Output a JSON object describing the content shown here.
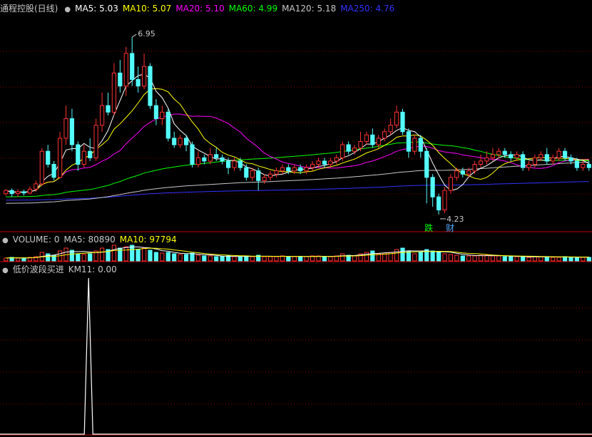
{
  "price_panel": {
    "title": "通程控股(日线)",
    "ma_labels": [
      {
        "text": "MA5: 5.03",
        "color": "#ffffff"
      },
      {
        "text": "MA10: 5.07",
        "color": "#ffff00"
      },
      {
        "text": "MA20: 5.10",
        "color": "#ff00ff"
      },
      {
        "text": "MA60: 4.99",
        "color": "#00ff00"
      },
      {
        "text": "MA120: 5.18",
        "color": "#c8c8c8"
      },
      {
        "text": "MA250: 4.76",
        "color": "#3333ff"
      }
    ],
    "high_label": "6.95",
    "low_label": "4.23",
    "tag_left": "跌",
    "tag_right": "财"
  },
  "volume_panel": {
    "labels": [
      {
        "text": "VOLUME: 0",
        "color": "#c8c8c8"
      },
      {
        "text": "MA5: 80890",
        "color": "#c8c8c8"
      },
      {
        "text": "MA10: 97794",
        "color": "#ffff00"
      }
    ]
  },
  "indicator_panel": {
    "labels": [
      {
        "text": "低价波段买进",
        "color": "#c8c8c8"
      },
      {
        "text": "KM11: 0.00",
        "color": "#c8c8c8"
      }
    ]
  },
  "colors": {
    "up": "#ff3232",
    "down": "#54fcfc",
    "grid": "#8b0000",
    "border": "#c80000"
  },
  "chart_data": {
    "type": "candlestick",
    "ylim": [
      4.0,
      7.3
    ],
    "candles": [
      [
        4.55,
        4.6,
        4.52,
        4.62
      ],
      [
        4.6,
        4.55,
        4.5,
        4.63
      ],
      [
        4.55,
        4.58,
        4.5,
        4.62
      ],
      [
        4.58,
        4.56,
        4.52,
        4.61
      ],
      [
        4.56,
        4.62,
        4.54,
        4.66
      ],
      [
        4.62,
        4.7,
        4.58,
        4.75
      ],
      [
        4.7,
        5.2,
        4.68,
        5.25
      ],
      [
        5.2,
        5.0,
        4.95,
        5.3
      ],
      [
        5.0,
        4.8,
        4.75,
        5.05
      ],
      [
        4.8,
        5.4,
        4.78,
        5.5
      ],
      [
        5.4,
        5.7,
        5.3,
        5.9
      ],
      [
        5.7,
        5.3,
        5.2,
        5.85
      ],
      [
        5.3,
        5.0,
        4.9,
        5.35
      ],
      [
        5.0,
        5.2,
        4.95,
        5.3
      ],
      [
        5.2,
        5.1,
        5.05,
        5.4
      ],
      [
        5.1,
        5.6,
        5.05,
        5.7
      ],
      [
        5.6,
        5.9,
        5.5,
        6.1
      ],
      [
        5.9,
        5.8,
        5.75,
        6.1
      ],
      [
        5.8,
        6.4,
        5.75,
        6.55
      ],
      [
        6.4,
        6.2,
        6.1,
        6.6
      ],
      [
        6.2,
        6.7,
        6.05,
        6.8
      ],
      [
        6.7,
        6.3,
        6.2,
        6.95
      ],
      [
        6.3,
        6.2,
        6.1,
        6.5
      ],
      [
        6.2,
        6.5,
        6.15,
        6.7
      ],
      [
        6.5,
        5.9,
        5.85,
        6.55
      ],
      [
        5.9,
        5.7,
        5.6,
        6.0
      ],
      [
        5.7,
        5.8,
        5.6,
        5.9
      ],
      [
        5.8,
        5.4,
        5.35,
        5.85
      ],
      [
        5.4,
        5.3,
        5.25,
        5.5
      ],
      [
        5.3,
        5.4,
        5.25,
        5.45
      ],
      [
        5.4,
        5.3,
        5.2,
        5.45
      ],
      [
        5.3,
        5.0,
        4.95,
        5.35
      ],
      [
        5.0,
        5.1,
        4.95,
        5.2
      ],
      [
        5.1,
        5.05,
        5.0,
        5.15
      ],
      [
        5.05,
        5.15,
        5.0,
        5.25
      ],
      [
        5.15,
        5.1,
        5.05,
        5.25
      ],
      [
        5.1,
        5.05,
        5.0,
        5.15
      ],
      [
        5.05,
        4.95,
        4.85,
        5.1
      ],
      [
        4.95,
        5.05,
        4.9,
        5.1
      ],
      [
        5.05,
        4.95,
        4.9,
        5.1
      ],
      [
        4.95,
        4.8,
        4.75,
        5.0
      ],
      [
        4.8,
        4.9,
        4.75,
        4.95
      ],
      [
        4.9,
        4.75,
        4.6,
        4.95
      ],
      [
        4.75,
        4.8,
        4.7,
        4.85
      ],
      [
        4.8,
        4.85,
        4.75,
        4.9
      ],
      [
        4.85,
        4.9,
        4.8,
        4.95
      ],
      [
        4.9,
        4.95,
        4.85,
        5.0
      ],
      [
        4.95,
        4.9,
        4.85,
        5.0
      ],
      [
        4.9,
        4.95,
        4.85,
        5.0
      ],
      [
        4.95,
        4.9,
        4.85,
        5.0
      ],
      [
        4.9,
        4.95,
        4.85,
        5.0
      ],
      [
        4.95,
        5.0,
        4.9,
        5.05
      ],
      [
        5.0,
        5.05,
        4.95,
        5.1
      ],
      [
        5.05,
        5.0,
        4.95,
        5.1
      ],
      [
        5.0,
        5.05,
        4.95,
        5.1
      ],
      [
        5.05,
        5.1,
        5.0,
        5.15
      ],
      [
        5.1,
        5.3,
        5.05,
        5.35
      ],
      [
        5.3,
        5.2,
        5.15,
        5.35
      ],
      [
        5.2,
        5.25,
        5.15,
        5.3
      ],
      [
        5.25,
        5.35,
        5.2,
        5.5
      ],
      [
        5.35,
        5.45,
        5.3,
        5.5
      ],
      [
        5.45,
        5.3,
        5.25,
        5.55
      ],
      [
        5.3,
        5.4,
        5.25,
        5.45
      ],
      [
        5.4,
        5.5,
        5.35,
        5.55
      ],
      [
        5.5,
        5.6,
        5.45,
        5.7
      ],
      [
        5.6,
        5.8,
        5.55,
        5.9
      ],
      [
        5.8,
        5.5,
        5.45,
        5.85
      ],
      [
        5.5,
        5.2,
        5.1,
        5.55
      ],
      [
        5.2,
        5.4,
        5.15,
        5.45
      ],
      [
        5.4,
        5.2,
        5.1,
        5.45
      ],
      [
        5.2,
        4.8,
        4.4,
        5.25
      ],
      [
        4.8,
        4.5,
        4.35,
        4.85
      ],
      [
        4.5,
        4.3,
        4.23,
        4.55
      ],
      [
        4.3,
        4.6,
        4.25,
        4.65
      ],
      [
        4.6,
        4.8,
        4.55,
        4.85
      ],
      [
        4.8,
        4.9,
        4.75,
        4.95
      ],
      [
        4.9,
        4.85,
        4.8,
        4.95
      ],
      [
        4.85,
        4.9,
        4.8,
        4.95
      ],
      [
        4.9,
        5.0,
        4.85,
        5.05
      ],
      [
        5.0,
        5.05,
        4.95,
        5.15
      ],
      [
        5.05,
        5.1,
        5.0,
        5.2
      ],
      [
        5.1,
        5.15,
        5.05,
        5.25
      ],
      [
        5.15,
        5.2,
        5.1,
        5.25
      ],
      [
        5.2,
        5.15,
        5.1,
        5.25
      ],
      [
        5.15,
        5.1,
        5.05,
        5.2
      ],
      [
        5.1,
        5.15,
        5.05,
        5.2
      ],
      [
        5.15,
        4.95,
        4.9,
        5.2
      ],
      [
        4.95,
        5.0,
        4.9,
        5.05
      ],
      [
        5.0,
        5.1,
        4.95,
        5.15
      ],
      [
        5.1,
        5.15,
        5.05,
        5.2
      ],
      [
        5.15,
        5.05,
        5.0,
        5.25
      ],
      [
        5.05,
        5.1,
        5.0,
        5.15
      ],
      [
        5.1,
        5.2,
        5.05,
        5.25
      ],
      [
        5.2,
        5.1,
        5.05,
        5.25
      ],
      [
        5.1,
        5.05,
        5.0,
        5.15
      ],
      [
        5.05,
        4.95,
        4.9,
        5.1
      ],
      [
        4.95,
        5.0,
        4.9,
        5.05
      ],
      [
        5.0,
        4.95,
        4.9,
        5.05
      ]
    ],
    "volume": [
      4,
      5,
      4,
      4,
      5,
      6,
      12,
      10,
      8,
      14,
      18,
      15,
      10,
      9,
      10,
      14,
      18,
      16,
      22,
      18,
      20,
      22,
      16,
      18,
      15,
      12,
      11,
      12,
      10,
      9,
      9,
      11,
      8,
      7,
      7,
      6,
      6,
      7,
      6,
      6,
      7,
      6,
      8,
      6,
      6,
      6,
      7,
      6,
      6,
      6,
      6,
      7,
      7,
      6,
      6,
      7,
      10,
      8,
      7,
      10,
      12,
      14,
      10,
      11,
      12,
      16,
      18,
      14,
      10,
      12,
      16,
      14,
      12,
      10,
      9,
      8,
      7,
      7,
      7,
      8,
      8,
      7,
      7,
      6,
      6,
      6,
      6,
      5,
      6,
      6,
      6,
      5,
      5,
      6,
      5,
      5,
      5,
      5
    ],
    "km11": [
      0,
      0,
      0,
      0,
      0,
      0,
      0,
      0,
      0,
      0,
      0,
      0,
      0,
      0,
      0,
      0,
      0,
      0,
      0,
      0,
      0,
      0,
      0,
      0,
      0,
      0,
      0,
      0,
      0,
      0,
      0,
      0,
      0,
      0,
      0,
      0,
      0,
      0,
      0,
      0,
      0,
      0,
      0,
      0,
      0,
      0,
      0,
      0,
      0,
      0,
      0,
      0,
      0,
      0,
      0,
      0,
      0,
      0,
      0,
      0,
      0,
      0,
      0,
      0,
      0,
      0,
      0,
      0,
      0,
      0,
      0,
      0,
      0,
      0,
      0,
      0,
      0,
      0,
      0,
      0,
      0,
      0,
      0,
      0,
      0,
      0,
      0,
      0,
      0,
      0,
      0,
      0,
      0,
      0,
      0,
      0,
      0,
      0
    ],
    "km11_spike_index": 14,
    "km11_ylim": [
      0,
      1
    ]
  }
}
